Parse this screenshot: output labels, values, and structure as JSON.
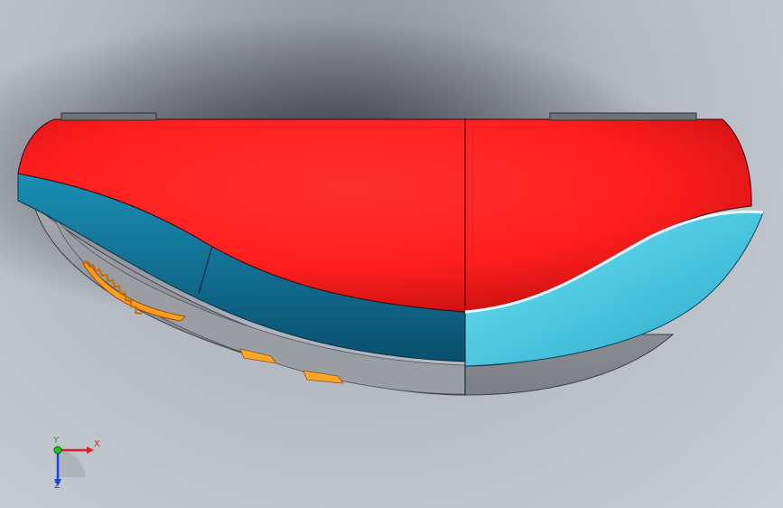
{
  "viewport": {
    "background": "#b8bcc4"
  },
  "model": {
    "colors": {
      "shell_red": "#ff2222",
      "band_blue_left": "#0f6f96",
      "band_blue_right": "#36c8e0",
      "base_gray": "#8e9197",
      "gear_orange": "#ff9a1e",
      "feet_orange": "#ffa528"
    }
  },
  "triad": {
    "x_label": "X",
    "y_label": "Y",
    "z_label": "Z",
    "colors": {
      "x": "#e02020",
      "y": "#20c020",
      "z": "#2040e0"
    }
  }
}
